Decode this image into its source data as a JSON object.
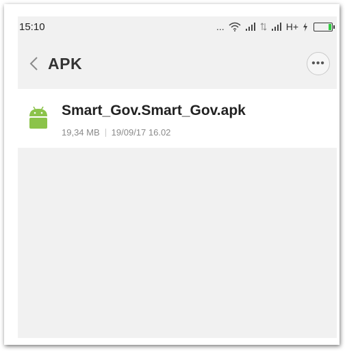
{
  "status_bar": {
    "time": "15:10",
    "dots": "...",
    "network_label": "H+"
  },
  "header": {
    "back_glyph": "<",
    "title": "APK",
    "more_glyph": "•••"
  },
  "files": [
    {
      "name": "Smart_Gov.Smart_Gov.apk",
      "size": "19,34 MB",
      "date": "19/09/17 16.02",
      "icon": "android-apk-icon"
    }
  ],
  "colors": {
    "android_green": "#8BC34A",
    "battery_fill": "#2ecc40"
  }
}
